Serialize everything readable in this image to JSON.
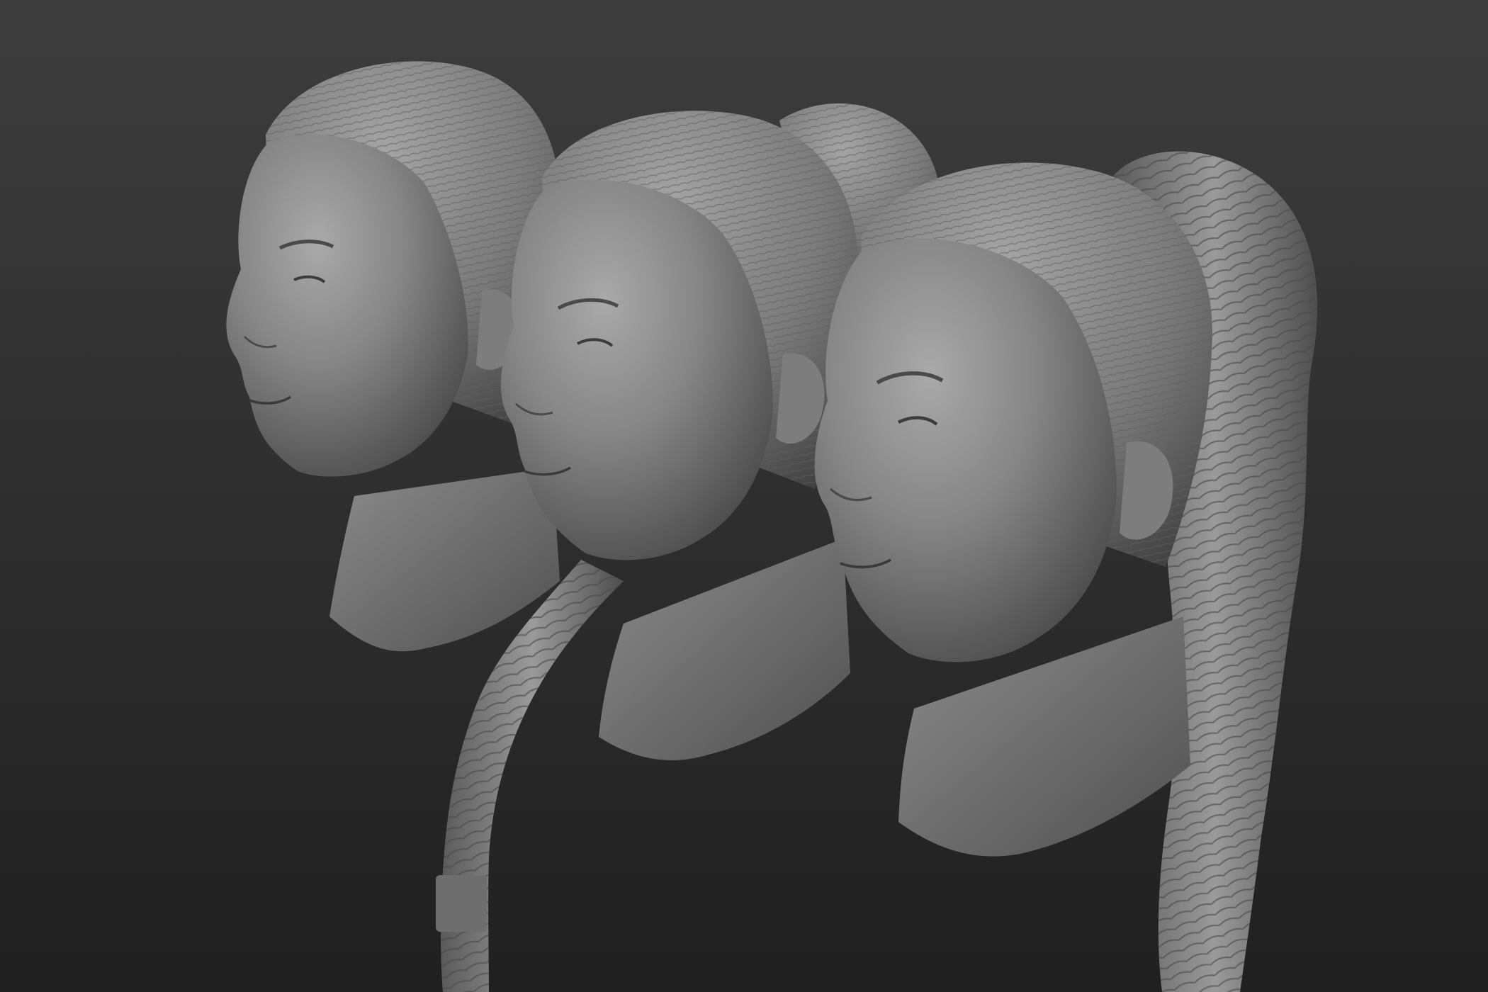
{
  "scene": {
    "background": {
      "top": "#3d3d3d",
      "bottom": "#202020"
    },
    "material": {
      "base": "#8a8a8a",
      "highlight": "#b8b8b8",
      "shadow": "#3c3c3c"
    },
    "figures": [
      {
        "name": "head-left",
        "hairstyle": "slicked-back"
      },
      {
        "name": "head-middle",
        "hairstyle": "long-braid"
      },
      {
        "name": "head-right",
        "hairstyle": "wrapped-ponytail"
      }
    ]
  }
}
